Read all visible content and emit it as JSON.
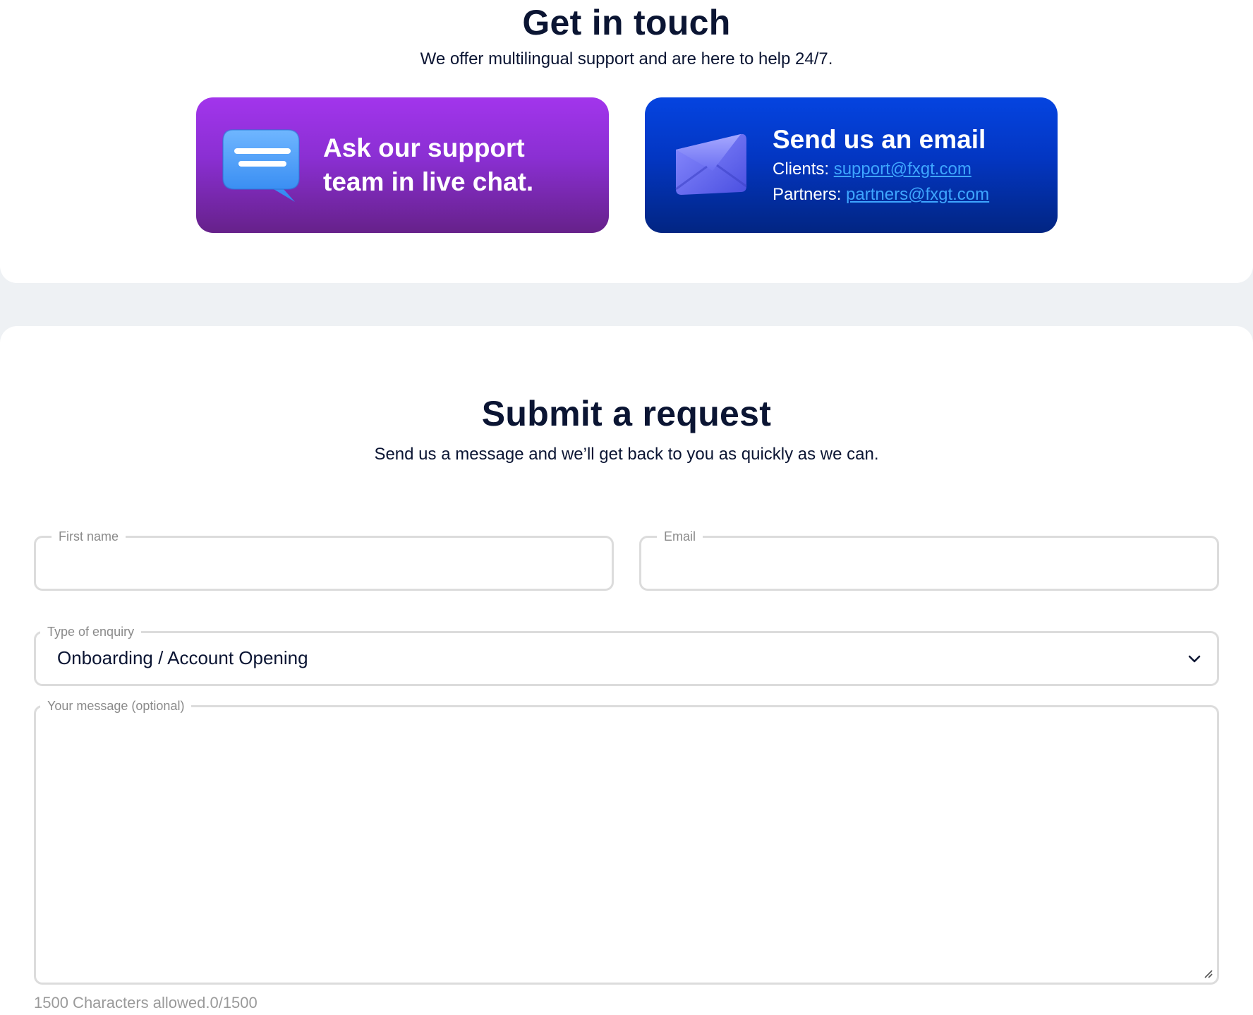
{
  "contact": {
    "title": "Get in touch",
    "subtitle": "We offer multilingual support and are here to help 24/7.",
    "chat_card": {
      "text": "Ask our support team in live chat.",
      "icon": "chat-bubble-icon"
    },
    "email_card": {
      "title": "Send us an email",
      "clients_label": "Clients:",
      "clients_email": "support@fxgt.com",
      "partners_label": "Partners:",
      "partners_email": "partners@fxgt.com",
      "icon": "envelope-icon"
    }
  },
  "request": {
    "title": "Submit a request",
    "subtitle": "Send us a message and we’ll get back to you as quickly as we can.",
    "first_name": {
      "label": "First name",
      "value": ""
    },
    "email": {
      "label": "Email",
      "value": ""
    },
    "enquiry": {
      "label": "Type of enquiry",
      "value": "Onboarding / Account Opening",
      "icon": "chevron-down-icon"
    },
    "message": {
      "label": "Your message (optional)",
      "value": ""
    },
    "char_note": "1500 Characters allowed.0/1500"
  },
  "colors": {
    "heading": "#0b1533",
    "chat_card_top": "#a235ec",
    "chat_card_bottom": "#66218a",
    "email_card_top": "#0544e0",
    "email_card_bottom": "#022582",
    "link": "#3ea6ff",
    "page_bg": "#eef1f4",
    "field_border": "#dcdcdc",
    "label": "#8a8a8a"
  }
}
